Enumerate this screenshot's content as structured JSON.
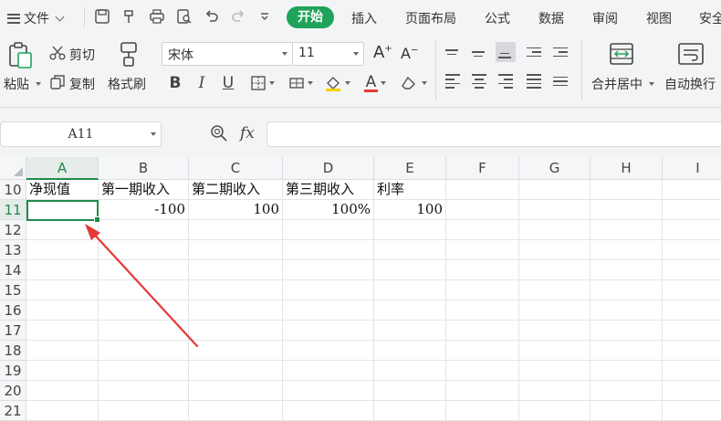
{
  "menu": {
    "file_label": "文件",
    "tabs": [
      "开始",
      "插入",
      "页面布局",
      "公式",
      "数据",
      "审阅",
      "视图",
      "安全"
    ]
  },
  "ribbon": {
    "paste_label": "粘贴",
    "cut_label": "剪切",
    "copy_label": "复制",
    "format_painter_label": "格式刷",
    "font_name": "宋体",
    "font_size": "11",
    "merge_center_label": "合并居中",
    "wrap_text_label": "自动换行"
  },
  "formula_bar": {
    "name_box": "A11",
    "fx_label": "fx",
    "formula": ""
  },
  "sheet": {
    "columns": [
      "A",
      "B",
      "C",
      "D",
      "E",
      "F",
      "G",
      "H",
      "I"
    ],
    "rows": [
      "10",
      "11",
      "12",
      "13",
      "14",
      "15",
      "16",
      "17",
      "18",
      "19",
      "20",
      "21"
    ],
    "selected_cell": "A11",
    "row10": [
      "净现值",
      "第一期收入",
      "第二期收入",
      "第三期收入",
      "利率"
    ],
    "row11": [
      "",
      "-100",
      "100",
      "100%",
      "100"
    ]
  },
  "colors": {
    "accent": "#1fa35a",
    "selection": "#1f8b4c",
    "annotation_arrow": "#e53935"
  }
}
